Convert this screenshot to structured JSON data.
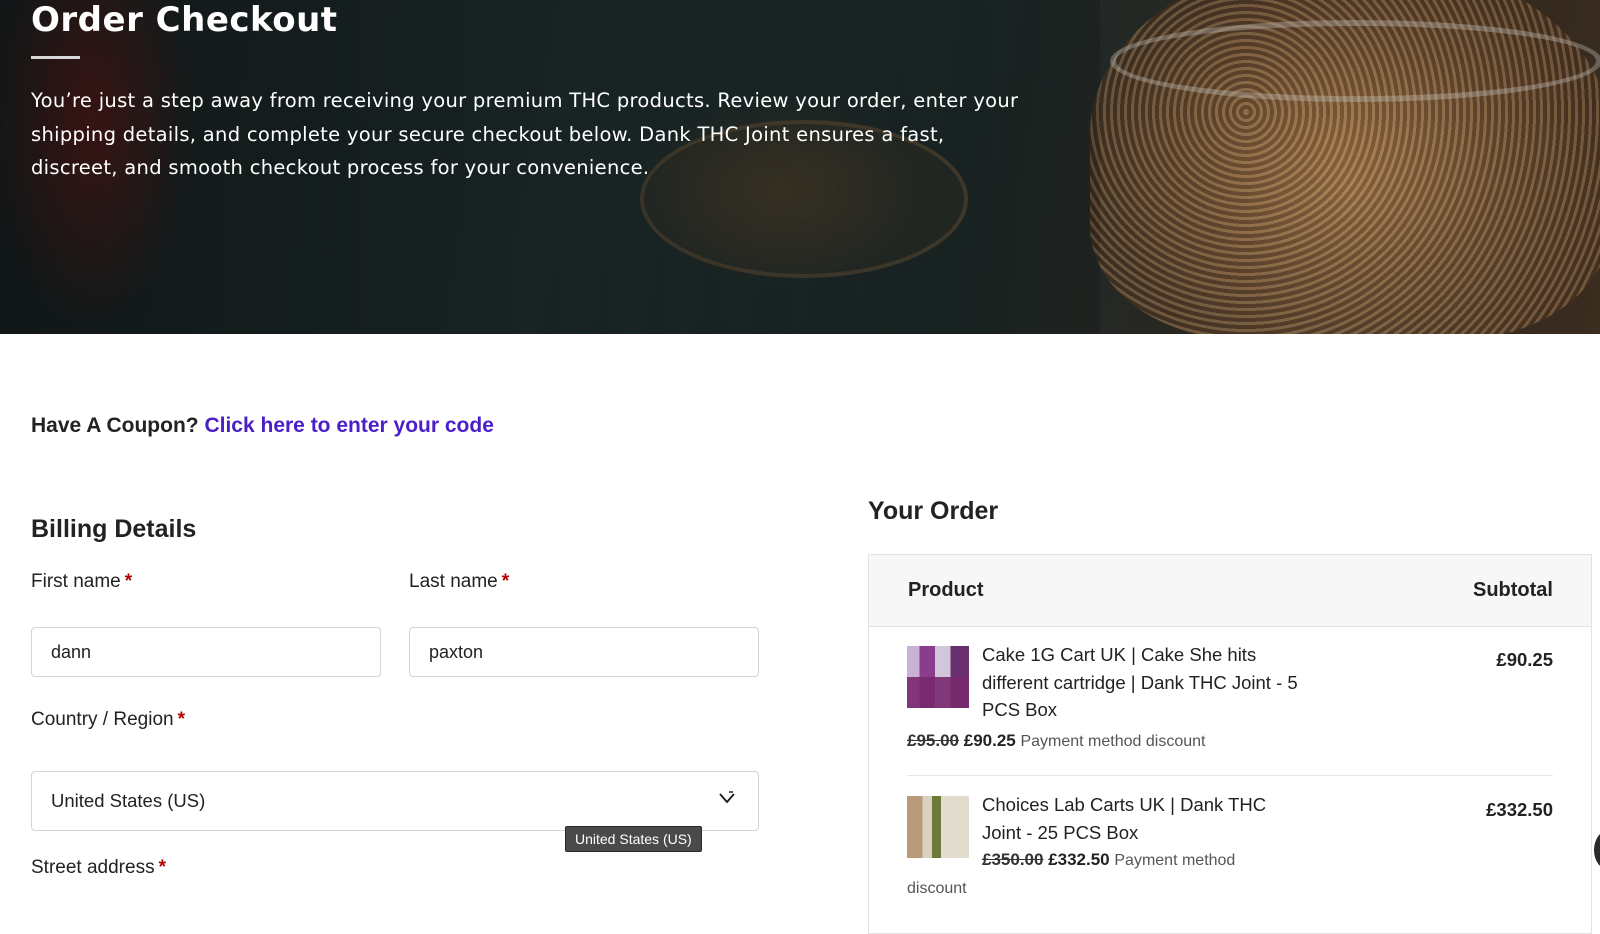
{
  "hero": {
    "title": "Order Checkout",
    "description": "You’re just a step away from receiving your premium THC products. Review your order, enter your shipping details, and complete your secure checkout below. Dank THC Joint ensures a fast, discreet, and smooth checkout process for your convenience."
  },
  "coupon": {
    "prompt": "Have A Coupon?",
    "link": "Click here to enter your code"
  },
  "billing": {
    "title": "Billing Details",
    "first_name_label": "First name",
    "first_name_value": "dann",
    "last_name_label": "Last name",
    "last_name_value": "paxton",
    "country_label": "Country / Region",
    "country_value": "United States (US)",
    "country_tooltip": "United States (US)",
    "street_label": "Street address",
    "required_mark": "*"
  },
  "order": {
    "title": "Your Order",
    "col_product": "Product",
    "col_subtotal": "Subtotal",
    "items": [
      {
        "name": "Cake 1G Cart UK | Cake She hits different cartridge | Dank THC Joint - 5 PCS Box",
        "line_total": "£90.25",
        "old_price": "£95.00",
        "new_price": "£90.25",
        "note": "Payment method discount"
      },
      {
        "name": "Choices Lab Carts UK | Dank THC Joint - 25 PCS Box",
        "line_total": "£332.50",
        "old_price": "£350.00",
        "new_price": "£332.50",
        "note_part1": "Payment method",
        "note_part2": "discount"
      }
    ]
  },
  "colors": {
    "link": "#4a1fc7",
    "required": "#b30000"
  }
}
